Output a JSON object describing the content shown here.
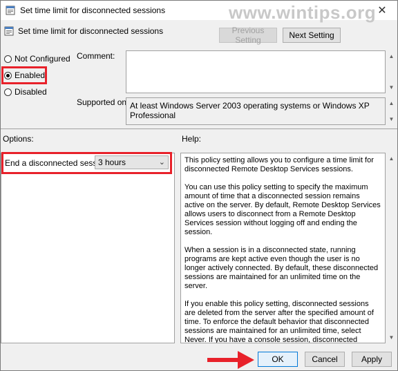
{
  "window": {
    "title": "Set time limit for disconnected sessions",
    "close_glyph": "✕",
    "watermark": "www.wintips.org"
  },
  "header": {
    "policy_name": "Set time limit for disconnected sessions",
    "previous_label": "Previous Setting",
    "next_label": "Next Setting"
  },
  "state": {
    "options": [
      {
        "label": "Not Configured",
        "checked": false
      },
      {
        "label": "Enabled",
        "checked": true
      },
      {
        "label": "Disabled",
        "checked": false
      }
    ]
  },
  "comment": {
    "label": "Comment:",
    "value": ""
  },
  "supported": {
    "label": "Supported on:",
    "value": "At least Windows Server 2003 operating systems or Windows XP Professional"
  },
  "options_section": {
    "label": "Options:",
    "setting_label": "End a disconnected session",
    "setting_value": "3 hours"
  },
  "help_section": {
    "label": "Help:",
    "paragraphs": [
      "This policy setting allows you to configure a time limit for disconnected Remote Desktop Services sessions.",
      "You can use this policy setting to specify the maximum amount of time that a disconnected session remains active on the server. By default, Remote Desktop Services allows users to disconnect from a Remote Desktop Services session without logging off and ending the session.",
      "When a session is in a disconnected state, running programs are kept active even though the user is no longer actively connected. By default, these disconnected sessions are maintained for an unlimited time on the server.",
      "If you enable this policy setting, disconnected sessions are deleted from the server after the specified amount of time. To enforce the default behavior that disconnected sessions are maintained for an unlimited time, select Never. If you have a console session, disconnected session time limits do not apply."
    ]
  },
  "footer": {
    "ok_label": "OK",
    "cancel_label": "Cancel",
    "apply_label": "Apply"
  },
  "colors": {
    "highlight": "#e8212a",
    "accent": "#0078d7"
  },
  "icons": {
    "window_icon": "policy-icon",
    "close": "close-icon"
  }
}
